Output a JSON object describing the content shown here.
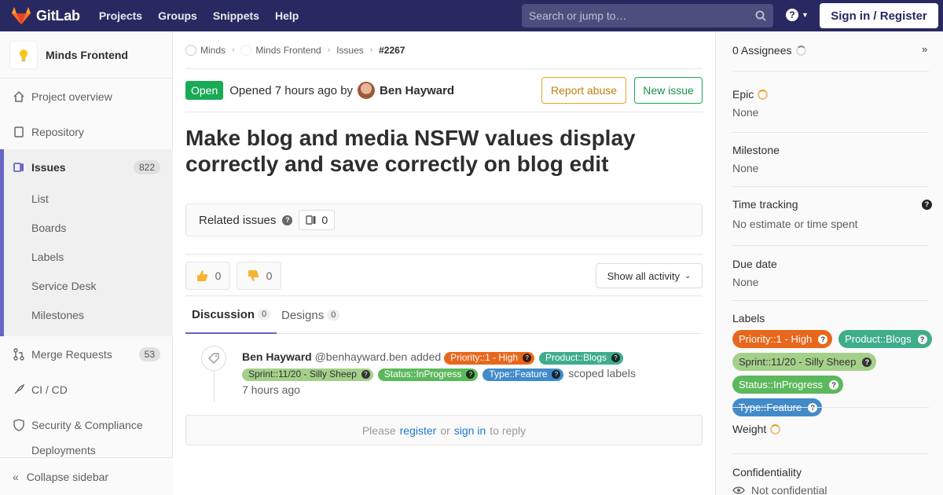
{
  "topnav": {
    "brand": "GitLab",
    "links": [
      "Projects",
      "Groups",
      "Snippets",
      "Help"
    ],
    "search_placeholder": "Search or jump to…",
    "signin": "Sign in / Register",
    "help_glyph": "?"
  },
  "sidebar": {
    "project": "Minds Frontend",
    "items": {
      "overview": "Project overview",
      "repository": "Repository",
      "issues": "Issues",
      "issues_count": "822",
      "merge": "Merge Requests",
      "merge_count": "53",
      "cicd": "CI / CD",
      "security": "Security & Compliance",
      "deploy": "Deployments"
    },
    "sub": [
      "List",
      "Boards",
      "Labels",
      "Service Desk",
      "Milestones"
    ],
    "collapse": "Collapse sidebar"
  },
  "breadcrumb": {
    "group": "Minds",
    "project": "Minds Frontend",
    "section": "Issues",
    "issue": "#2267"
  },
  "issue": {
    "status": "Open",
    "opened_prefix": "Opened 7 hours ago by",
    "author": "Ben Hayward",
    "report": "Report abuse",
    "new": "New issue",
    "title": "Make blog and media NSFW values display correctly and save correctly on blog edit"
  },
  "related": {
    "label": "Related issues",
    "count": "0"
  },
  "awards": {
    "up": "0",
    "down": "0",
    "activity": "Show all activity"
  },
  "tabs": {
    "discussion": "Discussion",
    "discussion_count": "0",
    "designs": "Designs",
    "designs_count": "0"
  },
  "note": {
    "author": "Ben Hayward",
    "handle": "@benhayward.ben",
    "action": "added",
    "suffix": "scoped labels",
    "time": "7 hours ago"
  },
  "labels": [
    {
      "text": "Priority::1 - High",
      "color": "#e8671d",
      "light": false
    },
    {
      "text": "Product::Blogs",
      "color": "#3fad8a",
      "light": false
    },
    {
      "text": "Sprint::11/20 - Silly Sheep",
      "color": "#a4d18a",
      "light": true
    },
    {
      "text": "Status::InProgress",
      "color": "#5cb85c",
      "light": false
    },
    {
      "text": "Type::Feature",
      "color": "#428bca",
      "light": false
    }
  ],
  "reply": {
    "please": "Please",
    "register": "register",
    "or": "or",
    "signin": "sign in",
    "to_reply": "to reply"
  },
  "rsb": {
    "assignees": "0 Assignees",
    "epic": "Epic",
    "epic_val": "None",
    "milestone": "Milestone",
    "milestone_val": "None",
    "time": "Time tracking",
    "time_val": "No estimate or time spent",
    "due": "Due date",
    "due_val": "None",
    "labels": "Labels",
    "weight": "Weight",
    "conf": "Confidentiality",
    "conf_val": "Not confidential"
  }
}
